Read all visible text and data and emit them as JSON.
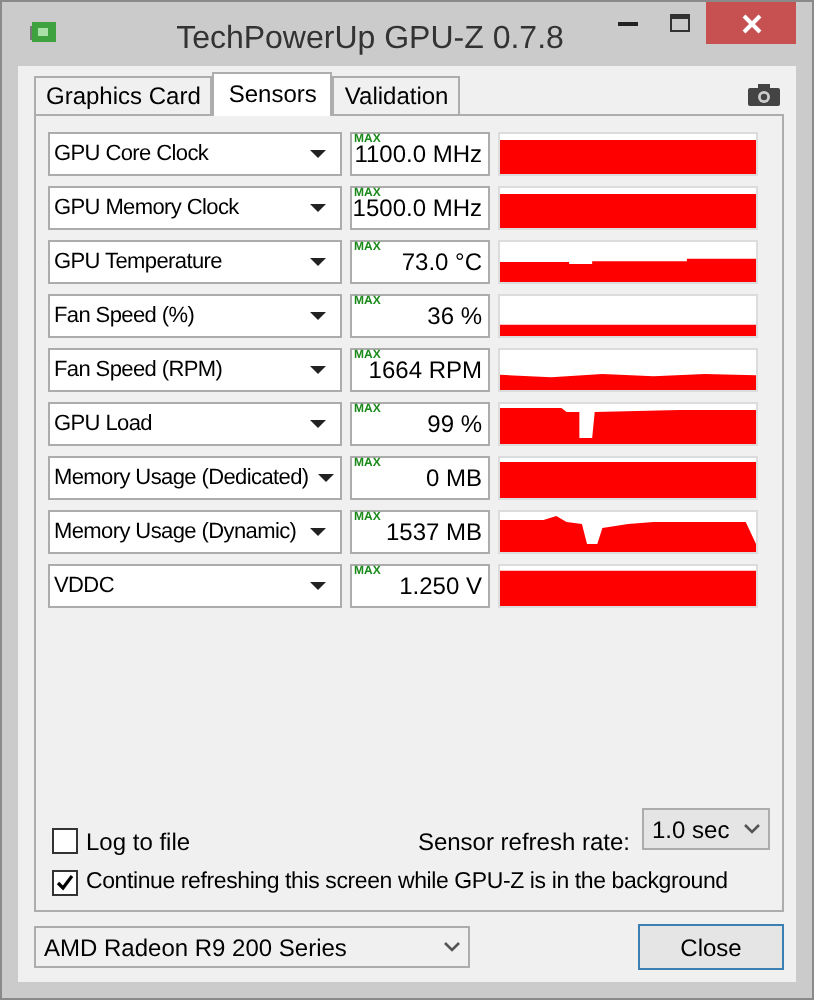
{
  "window": {
    "title": "TechPowerUp GPU-Z 0.7.8"
  },
  "tabs": [
    {
      "label": "Graphics Card",
      "selected": false
    },
    {
      "label": "Sensors",
      "selected": true
    },
    {
      "label": "Validation",
      "selected": false
    }
  ],
  "sensors": [
    {
      "name": "GPU Core Clock",
      "max": "MAX",
      "value": "1100.0 MHz"
    },
    {
      "name": "GPU Memory Clock",
      "max": "MAX",
      "value": "1500.0 MHz"
    },
    {
      "name": "GPU Temperature",
      "max": "MAX",
      "value": "73.0 °C"
    },
    {
      "name": "Fan Speed (%)",
      "max": "MAX",
      "value": "36 %"
    },
    {
      "name": "Fan Speed (RPM)",
      "max": "MAX",
      "value": "1664 RPM"
    },
    {
      "name": "GPU Load",
      "max": "MAX",
      "value": "99 %"
    },
    {
      "name": "Memory Usage (Dedicated)",
      "max": "MAX",
      "value": "0 MB"
    },
    {
      "name": "Memory Usage (Dynamic)",
      "max": "MAX",
      "value": "1537 MB"
    },
    {
      "name": "VDDC",
      "max": "MAX",
      "value": "1.250 V"
    }
  ],
  "log_to_file": {
    "label": "Log to file",
    "checked": false
  },
  "refresh_rate": {
    "label": "Sensor refresh rate:",
    "value": "1.0 sec"
  },
  "continue_refreshing": {
    "label": "Continue refreshing this screen while GPU-Z is in the background",
    "checked": true
  },
  "device": "AMD Radeon R9 200 Series",
  "close_button": "Close"
}
